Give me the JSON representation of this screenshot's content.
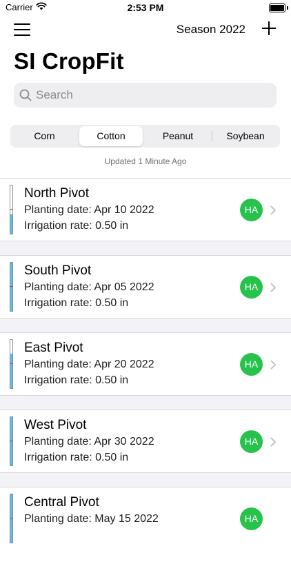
{
  "status_bar": {
    "carrier": "Carrier",
    "time": "2:53 PM"
  },
  "nav": {
    "season_label": "Season 2022"
  },
  "title": "SI CropFit",
  "search": {
    "placeholder": "Search"
  },
  "crop_tabs": [
    {
      "label": "Corn",
      "selected": false
    },
    {
      "label": "Cotton",
      "selected": true
    },
    {
      "label": "Peanut",
      "selected": false
    },
    {
      "label": "Soybean",
      "selected": false
    }
  ],
  "updated_text": "Updated 1 Minute Ago",
  "fields": [
    {
      "name": "North Pivot",
      "planting": "Planting date: Apr 10 2022",
      "irrigation": "Irrigation rate: 0.50 in",
      "badge": "HA",
      "level": 0.4,
      "mark": 0.5
    },
    {
      "name": "South Pivot",
      "planting": "Planting date: Apr 05 2022",
      "irrigation": "Irrigation rate: 0.50 in",
      "badge": "HA",
      "level": 1.0,
      "mark": 0.5
    },
    {
      "name": "East Pivot",
      "planting": "Planting date: Apr 20 2022",
      "irrigation": "Irrigation rate: 0.50 in",
      "badge": "HA",
      "level": 0.72,
      "mark": 0.5
    },
    {
      "name": "West Pivot",
      "planting": "Planting date: Apr 30 2022",
      "irrigation": "Irrigation rate: 0.50 in",
      "badge": "HA",
      "level": 1.0,
      "mark": 0.5
    },
    {
      "name": "Central Pivot",
      "planting": "Planting date: May 15 2022",
      "irrigation": "",
      "badge": "HA",
      "level": 1.0,
      "mark": 0.5
    }
  ],
  "colors": {
    "badge": "#27c24c",
    "gauge_fill": "#5bc0e8",
    "gauge_mark": "#c0392b"
  }
}
